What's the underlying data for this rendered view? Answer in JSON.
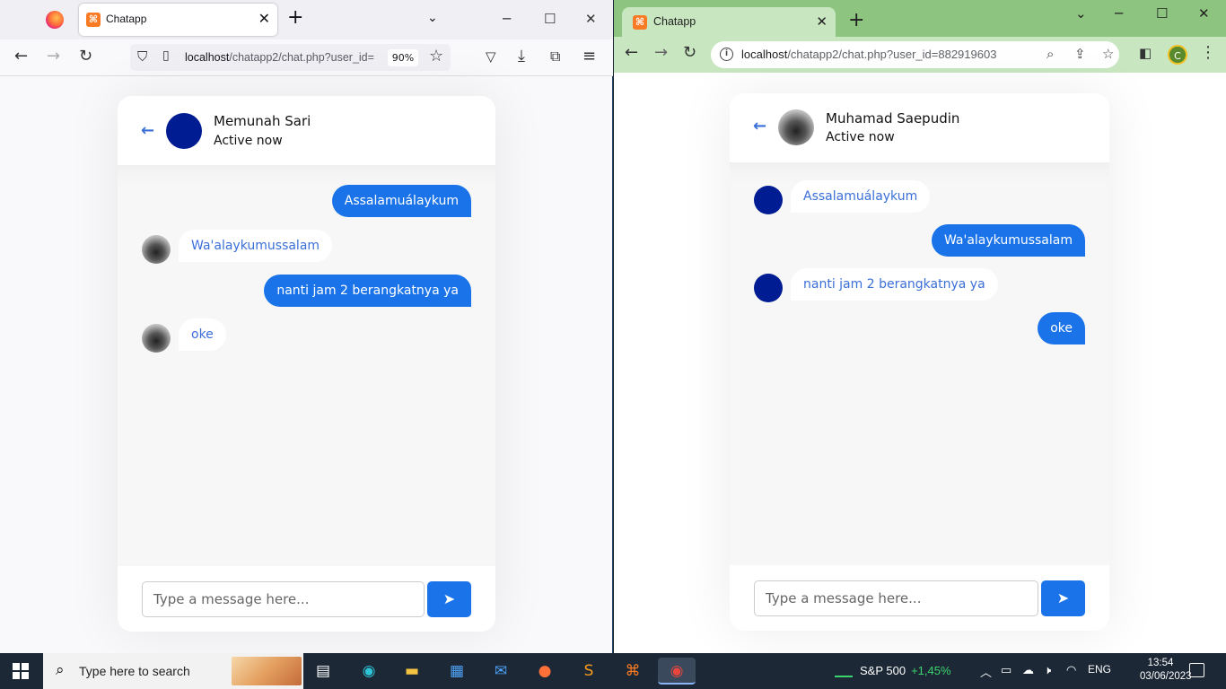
{
  "left_window": {
    "tab_title": "Chatapp",
    "url_host": "localhost",
    "url_path": "/chatapp2/chat.php?user_id=",
    "zoom": "90%",
    "chat": {
      "name": "Memunah Sari",
      "status": "Active now",
      "messages": [
        {
          "dir": "out",
          "text": "Assalamuálaykum"
        },
        {
          "dir": "in",
          "text": "Wa'alaykumussalam"
        },
        {
          "dir": "out",
          "text": "nanti jam 2 berangkatnya ya"
        },
        {
          "dir": "in",
          "text": "oke"
        }
      ],
      "input_placeholder": "Type a message here..."
    }
  },
  "right_window": {
    "tab_title": "Chatapp",
    "url_host": "localhost",
    "url_path": "/chatapp2/chat.php?user_id=882919603",
    "profile_initial": "C",
    "chat": {
      "name": "Muhamad Saepudin",
      "status": "Active now",
      "messages": [
        {
          "dir": "in",
          "text": "Assalamuálaykum"
        },
        {
          "dir": "out",
          "text": "Wa'alaykumussalam"
        },
        {
          "dir": "in",
          "text": "nanti jam 2 berangkatnya ya"
        },
        {
          "dir": "out",
          "text": "oke"
        }
      ],
      "input_placeholder": "Type a message here..."
    }
  },
  "taskbar": {
    "search_placeholder": "Type here to search",
    "stock_name": "S&P 500",
    "stock_change": "+1,45%",
    "language": "ENG",
    "time": "13:54",
    "date": "03/06/2023",
    "apps": [
      "task-view",
      "edge",
      "file-explorer",
      "store",
      "mail",
      "firefox",
      "sublime-text",
      "xampp",
      "chrome"
    ]
  },
  "colors": {
    "accent_blue": "#1a73e8",
    "avatar_navy": "#001c93",
    "chrome_frame_green": "#8dc47f",
    "xampp_orange": "#fb7a24"
  }
}
